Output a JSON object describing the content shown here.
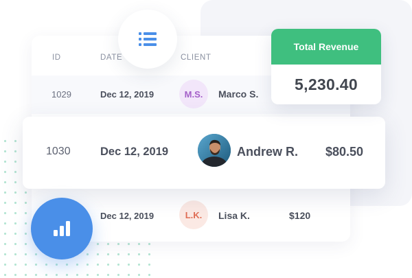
{
  "colors": {
    "accent_green": "#3fbf7f",
    "accent_blue": "#4a8fe8",
    "text_dark": "#4a4f5c",
    "badge_purple_bg": "#f2e6fa",
    "badge_purple_text": "#a45fc9",
    "badge_peach_bg": "#fbe9e4",
    "badge_peach_text": "#e06d55"
  },
  "icons": {
    "list": "list-icon",
    "bar_chart": "bar-chart-icon",
    "avatar": "avatar-photo"
  },
  "table": {
    "headers": {
      "id": "ID",
      "date": "DATE",
      "client": "CLIENT"
    },
    "rows": [
      {
        "id": "1029",
        "date": "Dec 12, 2019",
        "initials": "M.S.",
        "name": "Marco S.",
        "amount": ""
      },
      {
        "id": "1030",
        "date": "Dec 12, 2019",
        "initials": "",
        "name": "Andrew R.",
        "amount": "$80.50"
      },
      {
        "id": "",
        "date": "Dec 12, 2019",
        "initials": "L.K.",
        "name": "Lisa K.",
        "amount": "$120"
      }
    ]
  },
  "revenue": {
    "label": "Total Revenue",
    "value": "5,230.40"
  }
}
